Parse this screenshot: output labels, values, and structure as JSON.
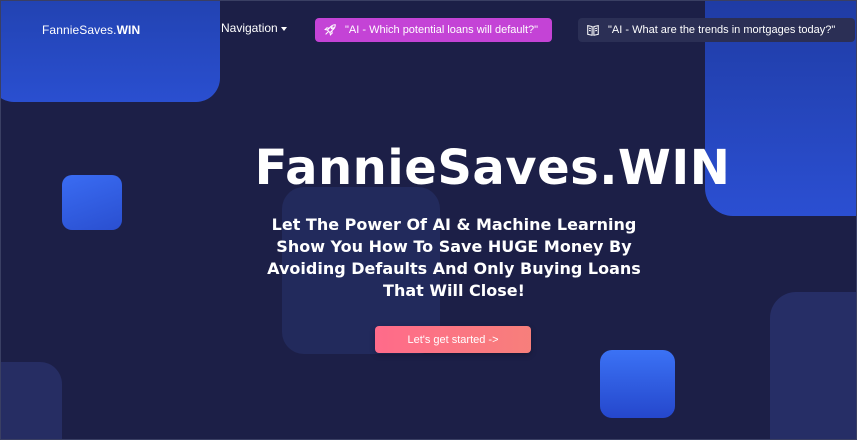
{
  "brand": {
    "light": "FannieSaves.",
    "bold": "WIN"
  },
  "nav": {
    "label": "Navigation"
  },
  "ai_buttons": [
    {
      "label": "\"AI - Which potential loans will default?\"",
      "icon": "rocket-icon",
      "color": "#c443d6"
    },
    {
      "label": "\"AI - What are the trends in mortgages today?\"",
      "icon": "book-icon",
      "color": "#2b2f55"
    }
  ],
  "hero": {
    "title": "FannieSaves.WIN",
    "subtitle": "Let The Power Of AI & Machine Learning Show You How To Save HUGE Money By Avoiding Defaults And Only Buying Loans That Will Close!",
    "cta_label": "Let's get started ->"
  },
  "colors": {
    "background": "#1c1f47",
    "accent_blue": "#2a4fd0",
    "cta": "#ff6b8a"
  }
}
